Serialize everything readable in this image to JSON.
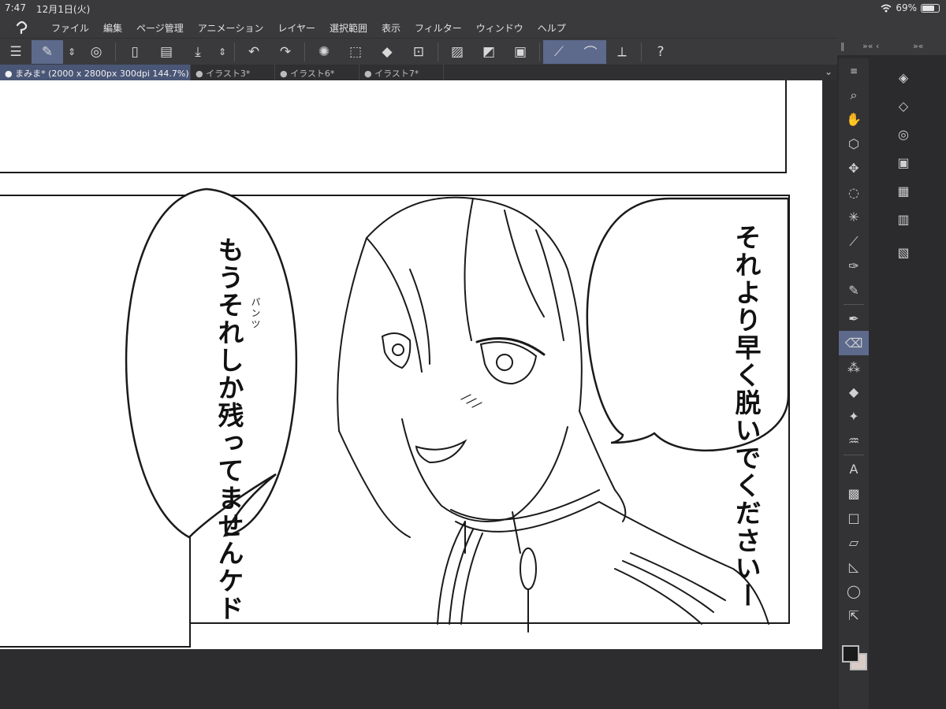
{
  "status_bar": {
    "time": "7:47",
    "date": "12月1日(火)",
    "wifi_icon": "wifi-icon",
    "battery_percent": "69%",
    "battery_level": 0.69
  },
  "menu": [
    "ファイル",
    "編集",
    "ページ管理",
    "アニメーション",
    "レイヤー",
    "選択範囲",
    "表示",
    "フィルター",
    "ウィンドウ",
    "ヘルプ"
  ],
  "tabs": [
    {
      "label": "● まみま* (2000 x 2800px 300dpi 144.7%)",
      "active": true
    },
    {
      "label": "● イラスト3*",
      "active": false
    },
    {
      "label": "● イラスト6*",
      "active": false
    },
    {
      "label": "● イラスト7*",
      "active": false
    }
  ],
  "manga": {
    "bubble_left": "もうそれしか残ってませんケド",
    "bubble_left_col1": "もうそれしか",
    "bubble_left_col2": "残ってませんケド",
    "furigana": "パンツ",
    "bubble_right_col1": "それより",
    "bubble_right_col2": "早く脱いで",
    "bubble_right_col3": "くださいー"
  },
  "colors": {
    "accent": "#5d6a8c",
    "ui_bg": "#3a3a3d",
    "main_color": "#1b1b1b",
    "sub_color": "#d9ccc6"
  }
}
